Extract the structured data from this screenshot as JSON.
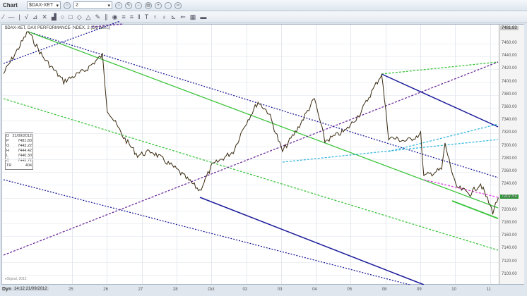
{
  "window": {
    "title": "Chart",
    "symbol": "$DAX-XET",
    "interval": "2"
  },
  "toolbar_tools": [
    "line",
    "horizontal",
    "vertical",
    "fib",
    "gann",
    "pitchfork",
    "text",
    "shape",
    "rect",
    "arrow",
    "triangle",
    "pen",
    "channel",
    "circle",
    "lines",
    "multi",
    "bars",
    "T",
    "marker",
    "marker2",
    "cursor",
    "arrow2",
    "grid",
    "bars2"
  ],
  "chart": {
    "header": "$DAX-XET, DAX PERFORMANCE-INDEX, 2 (Dynamic)",
    "top_value": "7481.83",
    "current_price": "7207.64",
    "colors": {
      "up": "#2f9a3a",
      "price": "#3a2a10",
      "channel": "#1c1c9a",
      "green": "#3cc43c",
      "purple": "#6a2a9a",
      "cyan": "#3ab8e0",
      "magenta": "#e040e0"
    },
    "data_box": [
      [
        "D",
        "21/09/2012"
      ],
      [
        "P",
        "7481.83"
      ],
      [
        "O",
        "7443.22"
      ],
      [
        "H",
        "7444.42"
      ],
      [
        "L",
        "7440.30"
      ],
      [
        "C",
        "7442.72"
      ],
      [
        "TR",
        "404"
      ]
    ],
    "watermark": "eSignal, 2012",
    "y_labels": [
      "7460.00",
      "7440.00",
      "7420.00",
      "7400.00",
      "7380.00",
      "7360.00",
      "7340.00",
      "7320.00",
      "7300.00",
      "7280.00",
      "7260.00",
      "7240.00",
      "7220.00",
      "7200.00",
      "7180.00",
      "7160.00",
      "7140.00",
      "7120.00",
      "7100.00"
    ],
    "x_labels": [
      "25",
      "26",
      "27",
      "28",
      "Oct",
      "02",
      "03",
      "04",
      "05",
      "08",
      "09",
      "10",
      "11"
    ],
    "footer": {
      "mode": "Dyn",
      "datetime": "14:12 21/09/2012"
    }
  },
  "chart_data": {
    "type": "line",
    "title": "$DAX-XET, DAX PERFORMANCE-INDEX, 2 (Dynamic)",
    "x_note": "x = day index, 0 = '25'",
    "ylim": [
      7085,
      7481.83
    ],
    "series": [
      {
        "name": "price",
        "points": [
          [
            -1.95,
            7412
          ],
          [
            -1.24,
            7478
          ],
          [
            -0.83,
            7439
          ],
          [
            -0.22,
            7400
          ],
          [
            0.39,
            7417
          ],
          [
            0.89,
            7441
          ],
          [
            1.03,
            7357
          ],
          [
            1.5,
            7313
          ],
          [
            1.9,
            7285
          ],
          [
            2.31,
            7291
          ],
          [
            3.02,
            7263
          ],
          [
            3.69,
            7230
          ],
          [
            4.04,
            7269
          ],
          [
            4.65,
            7291
          ],
          [
            4.95,
            7329
          ],
          [
            5.36,
            7368
          ],
          [
            5.67,
            7351
          ],
          [
            6.06,
            7291
          ],
          [
            6.47,
            7324
          ],
          [
            6.98,
            7373
          ],
          [
            7.28,
            7307
          ],
          [
            7.89,
            7324
          ],
          [
            8.3,
            7351
          ],
          [
            8.91,
            7412
          ],
          [
            9.11,
            7313
          ],
          [
            9.62,
            7307
          ],
          [
            10.03,
            7318
          ],
          [
            10.12,
            7252
          ],
          [
            10.63,
            7263
          ],
          [
            10.73,
            7302
          ],
          [
            11.04,
            7236
          ],
          [
            11.45,
            7225
          ],
          [
            11.75,
            7241
          ],
          [
            12.1,
            7197
          ],
          [
            12.26,
            7219
          ]
        ]
      }
    ]
  }
}
